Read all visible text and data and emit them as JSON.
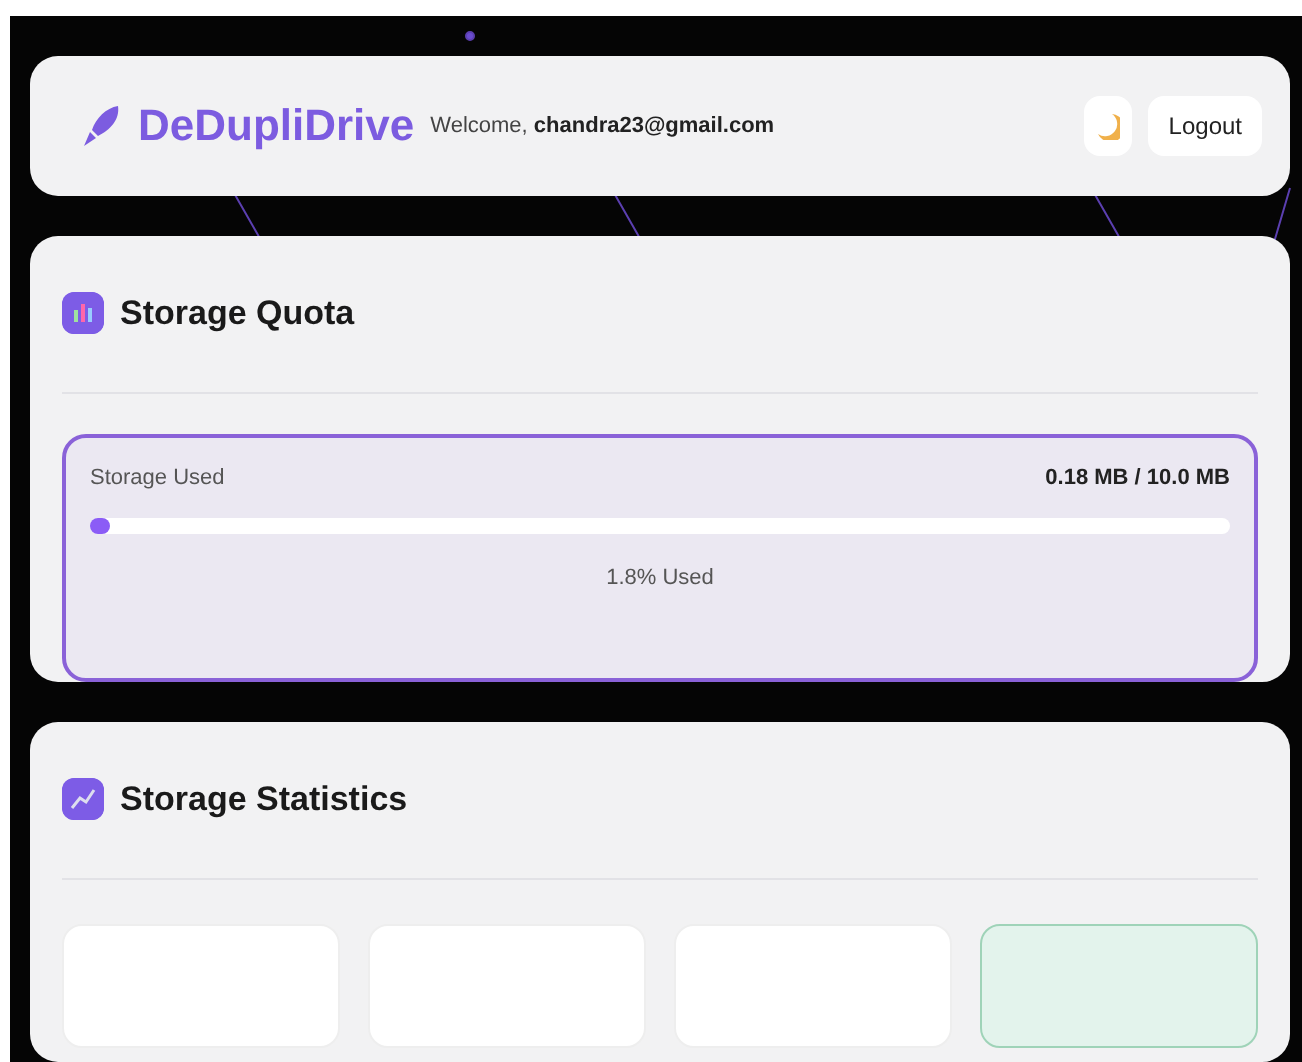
{
  "header": {
    "brand": "DeDupliDrive",
    "welcome": "Welcome, **chandra23@gmail.com**",
    "logout": "Logout"
  },
  "quota": {
    "title": "Storage Quota",
    "label": "Storage Used",
    "reading": "0.18 MB / 10.0 MB",
    "level": 0.018,
    "percent": "1.8% Used"
  },
  "statistics": {
    "title": "Storage Statistics",
    "cards": [
      {
        "highlighted": false
      },
      {
        "highlighted": false
      },
      {
        "highlighted": false
      },
      {
        "highlighted": true
      }
    ]
  }
}
